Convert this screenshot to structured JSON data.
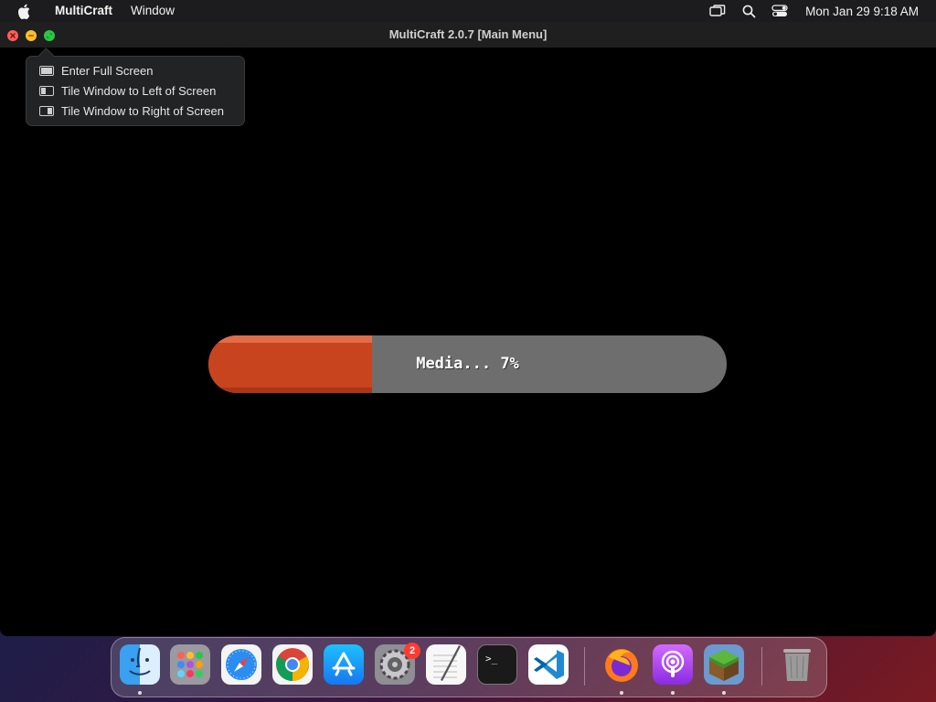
{
  "menubar": {
    "app_name": "MultiCraft",
    "menus": [
      "Window"
    ],
    "clock": "Mon Jan 29  9:18 AM",
    "status_icons": [
      "screen-mirroring-icon",
      "search-icon",
      "control-center-icon"
    ]
  },
  "window": {
    "title": "MultiCraft 2.0.7 [Main Menu]"
  },
  "popover": {
    "items": [
      {
        "label": "Enter Full Screen",
        "icon": "full-screen-icon"
      },
      {
        "label": "Tile Window to Left of Screen",
        "icon": "tile-left-icon"
      },
      {
        "label": "Tile Window to Right of Screen",
        "icon": "tile-right-icon"
      }
    ]
  },
  "loading": {
    "label": "Media... 7%",
    "progress": 0.315,
    "fill_color": "#c8441e",
    "track_color": "#6e6e6e"
  },
  "dock": {
    "apps": [
      {
        "name": "Finder",
        "icon": "finder-icon",
        "running": true
      },
      {
        "name": "Launchpad",
        "icon": "launchpad-icon",
        "running": false
      },
      {
        "name": "Safari",
        "icon": "safari-icon",
        "running": false
      },
      {
        "name": "Chrome",
        "icon": "chrome-icon",
        "running": false
      },
      {
        "name": "App Store",
        "icon": "app-store-icon",
        "running": false
      },
      {
        "name": "System Settings",
        "icon": "system-settings-icon",
        "running": false,
        "badge": "2"
      },
      {
        "name": "TextEdit",
        "icon": "textedit-icon",
        "running": false
      },
      {
        "name": "Terminal",
        "icon": "terminal-icon",
        "running": false
      },
      {
        "name": "Visual Studio Code",
        "icon": "vscode-icon",
        "running": false
      },
      {
        "name": "Firefox",
        "icon": "firefox-icon",
        "running": true
      },
      {
        "name": "Podcasts",
        "icon": "podcasts-icon",
        "running": true
      },
      {
        "name": "MultiCraft",
        "icon": "multicraft-icon",
        "running": true
      },
      {
        "name": "Trash",
        "icon": "trash-icon",
        "running": false
      }
    ]
  }
}
